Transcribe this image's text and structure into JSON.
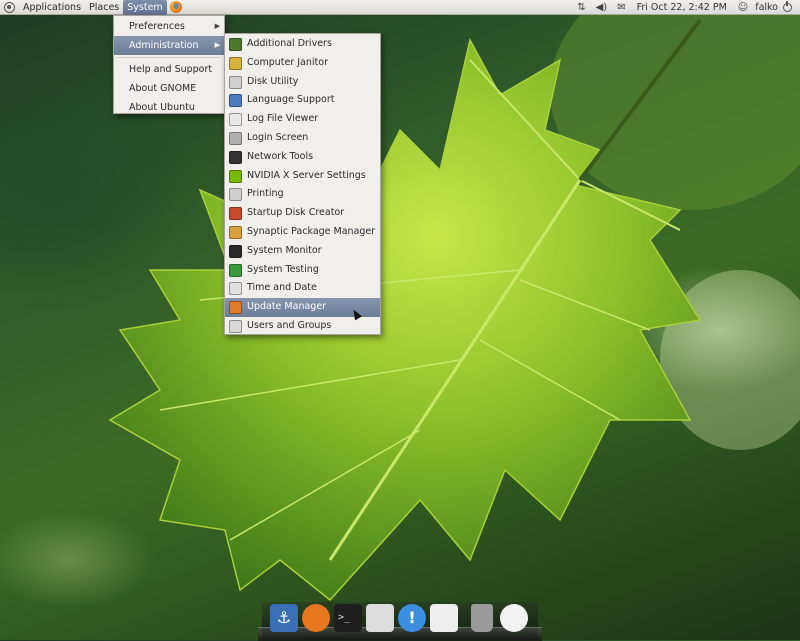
{
  "top_panel": {
    "menus": [
      {
        "label": "Applications"
      },
      {
        "label": "Places"
      },
      {
        "label": "System"
      }
    ],
    "clock": "Fri Oct 22,  2:42 PM",
    "user": "falko",
    "tray_icons": [
      "network-icon",
      "volume-icon",
      "mail-icon"
    ]
  },
  "system_menu": {
    "items": [
      {
        "label": "Preferences",
        "has_submenu": true
      },
      {
        "label": "Administration",
        "has_submenu": true,
        "highlighted": true
      },
      {
        "label": "Help and Support"
      },
      {
        "label": "About GNOME"
      },
      {
        "label": "About Ubuntu"
      }
    ]
  },
  "admin_menu": {
    "items": [
      {
        "label": "Additional Drivers",
        "icon": "drivers-icon",
        "color": "#4a7a2a"
      },
      {
        "label": "Computer Janitor",
        "icon": "broom-icon",
        "color": "#d8b23a"
      },
      {
        "label": "Disk Utility",
        "icon": "disk-icon",
        "color": "#d0d0d0"
      },
      {
        "label": "Language Support",
        "icon": "language-icon",
        "color": "#4c7cc0"
      },
      {
        "label": "Log File Viewer",
        "icon": "log-icon",
        "color": "#e8e8e8"
      },
      {
        "label": "Login Screen",
        "icon": "login-icon",
        "color": "#b0b0b0"
      },
      {
        "label": "Network Tools",
        "icon": "network-tools-icon",
        "color": "#333333"
      },
      {
        "label": "NVIDIA X Server Settings",
        "icon": "nvidia-icon",
        "color": "#76b900"
      },
      {
        "label": "Printing",
        "icon": "printer-icon",
        "color": "#cfcfcf"
      },
      {
        "label": "Startup Disk Creator",
        "icon": "startup-disk-icon",
        "color": "#c84a2a"
      },
      {
        "label": "Synaptic Package Manager",
        "icon": "package-icon",
        "color": "#d8a040"
      },
      {
        "label": "System Monitor",
        "icon": "monitor-icon",
        "color": "#2a2a2a"
      },
      {
        "label": "System Testing",
        "icon": "checkmark-icon",
        "color": "#3a9a3a"
      },
      {
        "label": "Time and Date",
        "icon": "calendar-icon",
        "color": "#e0e0e0"
      },
      {
        "label": "Update Manager",
        "icon": "update-icon",
        "color": "#e07a2a",
        "highlighted": true
      },
      {
        "label": "Users and Groups",
        "icon": "users-icon",
        "color": "#d8d8d8"
      }
    ]
  },
  "dock": {
    "items": [
      {
        "name": "anchor-icon",
        "color": "#3a6fb6"
      },
      {
        "name": "firefox-icon",
        "color": "#e8761e"
      },
      {
        "name": "terminal-icon",
        "color": "#1e1e1e"
      },
      {
        "name": "webcam-icon",
        "color": "#dcdcdc"
      },
      {
        "name": "notification-icon",
        "color": "#3b8ee0"
      },
      {
        "name": "text-editor-icon",
        "color": "#eeeeee"
      },
      {
        "name": "trash-icon",
        "color": "#9a9a9a"
      },
      {
        "name": "clock-icon",
        "color": "#f2f2f2"
      }
    ]
  }
}
